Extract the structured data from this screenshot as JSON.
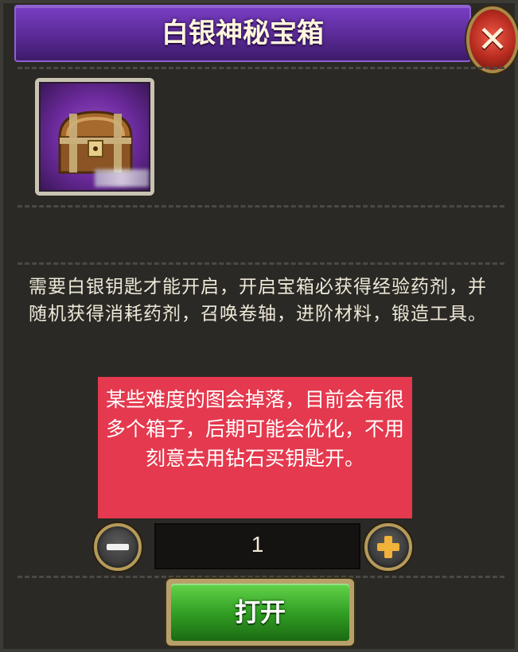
{
  "dialog": {
    "title": "白银神秘宝箱",
    "close_icon": "close-icon"
  },
  "item": {
    "icon": "treasure-chest-icon",
    "frame_color": "#7a3ec4"
  },
  "description": "需要白银钥匙才能开启，开启宝箱必获得经验药剂，并随机获得消耗药剂，召唤卷轴，进阶材料，锻造工具。",
  "annotation": {
    "text": "某些难度的图会掉落，目前会有很多个箱子，后期可能会优化，不用刻意去用钻石买钥匙开。",
    "background": "#e4394e"
  },
  "quantity": {
    "value": "1",
    "minus_icon": "minus-icon",
    "plus_icon": "plus-icon"
  },
  "open_button": {
    "label": "打开",
    "color": "#2f9b22"
  }
}
